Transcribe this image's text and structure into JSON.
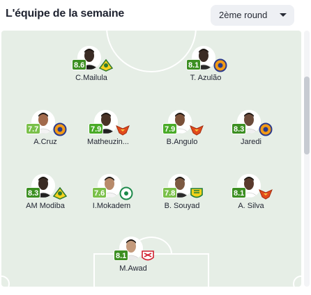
{
  "header": {
    "title": "L'équipe de la semaine",
    "round_select": {
      "selected": "2ème round"
    }
  },
  "colors": {
    "pitch": "#e6eee6",
    "rating_good": "#4aab28",
    "rating_very_good": "#3c8f22",
    "text": "#1f2330"
  },
  "players": [
    {
      "name": "C.Mailula",
      "rating": "8.6",
      "club_badge": "sundowns-badge"
    },
    {
      "name": "T. Azulão",
      "rating": "8.1",
      "club_badge": "orange-blue-badge"
    },
    {
      "name": "A.Cruz",
      "rating": "7.7",
      "club_badge": "orange-blue-badge"
    },
    {
      "name": "Matheuzin...",
      "rating": "7.9",
      "club_badge": "red-eagle-badge"
    },
    {
      "name": "B.Angulo",
      "rating": "7.9",
      "club_badge": "red-eagle-badge"
    },
    {
      "name": "Jaredi",
      "rating": "8.3",
      "club_badge": "orange-blue-badge"
    },
    {
      "name": "AM Modiba",
      "rating": "8.3",
      "club_badge": "sundowns-badge"
    },
    {
      "name": "I.Mokadem",
      "rating": "7.6",
      "club_badge": "green-white-badge"
    },
    {
      "name": "B. Souyad",
      "rating": "7.8",
      "club_badge": "yellow-green-badge"
    },
    {
      "name": "A. Silva",
      "rating": "8.1",
      "club_badge": "red-eagle-badge"
    },
    {
      "name": "M.Awad",
      "rating": "8.1",
      "club_badge": "zamalek-badge"
    }
  ]
}
